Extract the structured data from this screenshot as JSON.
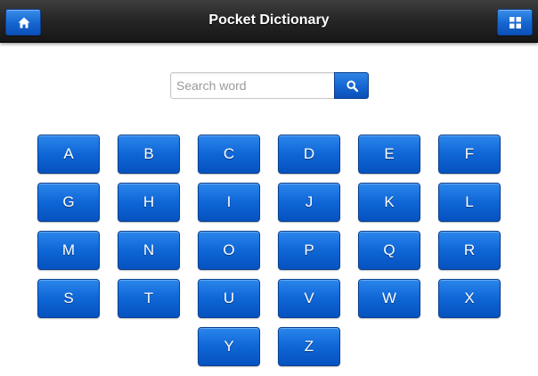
{
  "header": {
    "title": "Pocket Dictionary",
    "home_icon": "home-icon",
    "apps_icon": "grid-icon"
  },
  "search": {
    "placeholder": "Search word",
    "value": "",
    "icon": "search-icon"
  },
  "letters": [
    "A",
    "B",
    "C",
    "D",
    "E",
    "F",
    "G",
    "H",
    "I",
    "J",
    "K",
    "L",
    "M",
    "N",
    "O",
    "P",
    "Q",
    "R",
    "S",
    "T",
    "U",
    "V",
    "W",
    "X",
    "Y",
    "Z"
  ],
  "colors": {
    "header_background": "#1f1f1f",
    "button_blue": "#0f66d6",
    "button_text": "#ffffff"
  }
}
